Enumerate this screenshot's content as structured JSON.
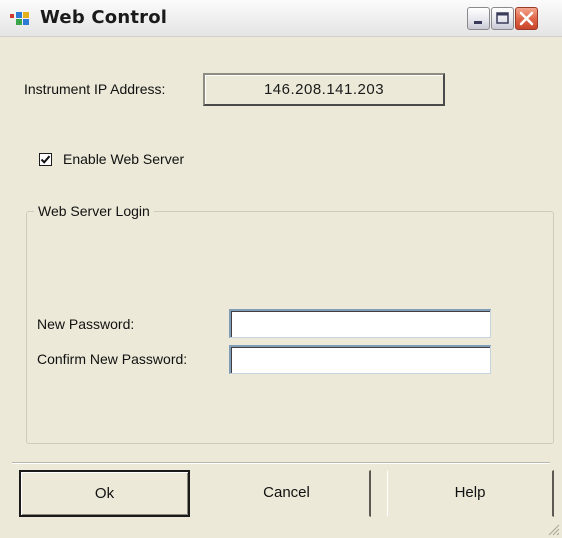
{
  "window": {
    "title": "Web Control",
    "icon": "app-icon",
    "controls": [
      "minimize-icon",
      "maximize-icon",
      "close-icon"
    ]
  },
  "instrument": {
    "ip_label": "Instrument IP Address:",
    "ip_value": "146.208.141.203"
  },
  "web_server": {
    "enable_label": "Enable Web Server",
    "enabled": true
  },
  "login_group": {
    "title": "Web Server Login",
    "new_password_label": "New Password:",
    "new_password_value": "",
    "confirm_password_label": "Confirm New Password:",
    "confirm_password_value": ""
  },
  "buttons": {
    "ok": "Ok",
    "cancel": "Cancel",
    "help": "Help"
  },
  "colors": {
    "dialog_background": "#ece9d8",
    "close_button": "#e0674a",
    "field_border": "#7f9db9"
  }
}
